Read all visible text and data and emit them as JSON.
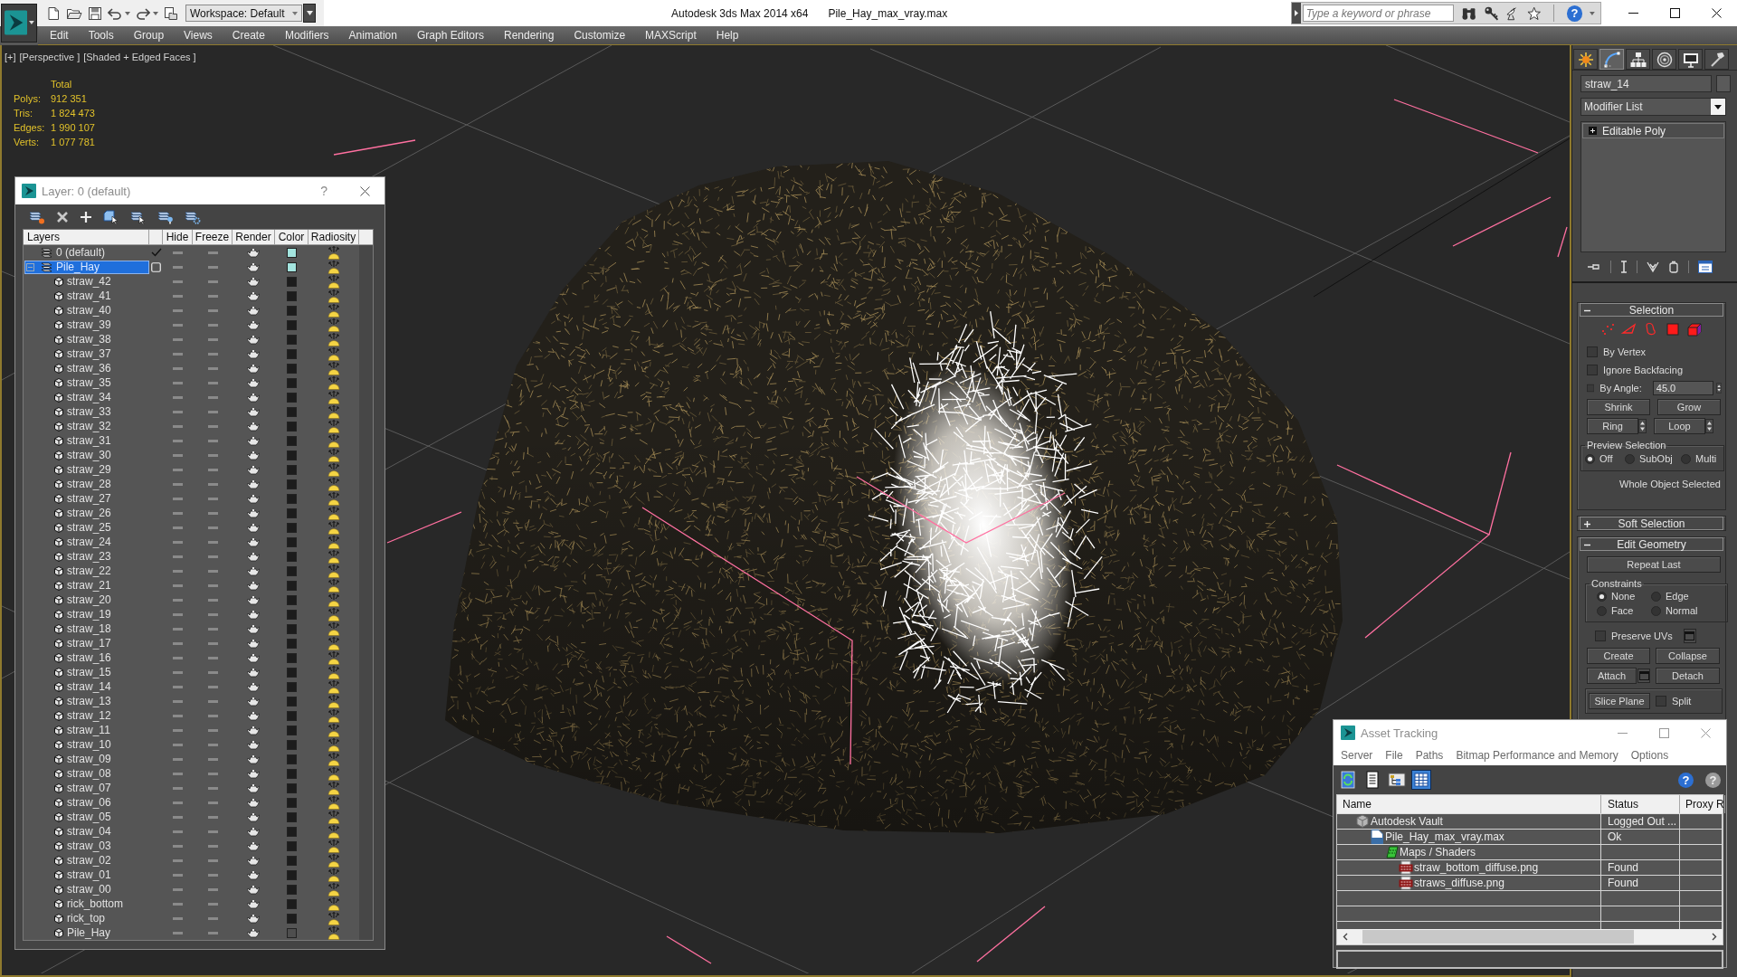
{
  "title_bar": {
    "workspace": "Workspace: Default",
    "app_title": "Autodesk 3ds Max 2014 x64",
    "file_name": "Pile_Hay_max_vray.max",
    "search": {
      "placeholder": "Type a keyword or phrase"
    },
    "help": "?"
  },
  "menu": [
    "Edit",
    "Tools",
    "Group",
    "Views",
    "Create",
    "Modifiers",
    "Animation",
    "Graph Editors",
    "Rendering",
    "Customize",
    "MAXScript",
    "Help"
  ],
  "viewport": {
    "labels": [
      "[+]",
      "[Perspective ]",
      "[Shaded + Edged Faces ]"
    ],
    "stats": {
      "header": "Total",
      "rows": [
        {
          "label": "Polys:",
          "value": "912 351"
        },
        {
          "label": "Tris:",
          "value": "1 824 473"
        },
        {
          "label": "Edges:",
          "value": "1 990 107"
        },
        {
          "label": "Verts:",
          "value": "1 077 781"
        }
      ]
    }
  },
  "layer_window": {
    "title": "Layer: 0 (default)",
    "help": "?",
    "columns": [
      "Layers",
      "Hide",
      "Freeze",
      "Render",
      "Color",
      "Radiosity"
    ],
    "layers": [
      {
        "name": "0 (default)",
        "current": true,
        "selected": false,
        "hidden": false,
        "frozen": false,
        "renderable": true,
        "radiosity": true,
        "color": "#a3e4de"
      },
      {
        "name": "Pile_Hay",
        "current": false,
        "selected": true,
        "expanded": true,
        "hidden": false,
        "frozen": false,
        "renderable": true,
        "radiosity": true,
        "color": "#a3e4de",
        "children": [
          {
            "name": "straw_42",
            "selected": false,
            "hidden": false,
            "frozen": false,
            "renderable": true,
            "radiosity": true,
            "color": "#1c1c1c"
          },
          {
            "name": "straw_41",
            "selected": false,
            "hidden": false,
            "frozen": false,
            "renderable": true,
            "radiosity": true,
            "color": "#1c1c1c"
          },
          {
            "name": "straw_40",
            "selected": false,
            "hidden": false,
            "frozen": false,
            "renderable": true,
            "radiosity": true,
            "color": "#1c1c1c"
          },
          {
            "name": "straw_39",
            "selected": false,
            "hidden": false,
            "frozen": false,
            "renderable": true,
            "radiosity": true,
            "color": "#1c1c1c"
          },
          {
            "name": "straw_38",
            "selected": false,
            "hidden": false,
            "frozen": false,
            "renderable": true,
            "radiosity": true,
            "color": "#1c1c1c"
          },
          {
            "name": "straw_37",
            "selected": false,
            "hidden": false,
            "frozen": false,
            "renderable": true,
            "radiosity": true,
            "color": "#1c1c1c"
          },
          {
            "name": "straw_36",
            "selected": false,
            "hidden": false,
            "frozen": false,
            "renderable": true,
            "radiosity": true,
            "color": "#1c1c1c"
          },
          {
            "name": "straw_35",
            "selected": false,
            "hidden": false,
            "frozen": false,
            "renderable": true,
            "radiosity": true,
            "color": "#1c1c1c"
          },
          {
            "name": "straw_34",
            "selected": false,
            "hidden": false,
            "frozen": false,
            "renderable": true,
            "radiosity": true,
            "color": "#1c1c1c"
          },
          {
            "name": "straw_33",
            "selected": false,
            "hidden": false,
            "frozen": false,
            "renderable": true,
            "radiosity": true,
            "color": "#1c1c1c"
          },
          {
            "name": "straw_32",
            "selected": false,
            "hidden": false,
            "frozen": false,
            "renderable": true,
            "radiosity": true,
            "color": "#1c1c1c"
          },
          {
            "name": "straw_31",
            "selected": false,
            "hidden": false,
            "frozen": false,
            "renderable": true,
            "radiosity": true,
            "color": "#1c1c1c"
          },
          {
            "name": "straw_30",
            "selected": false,
            "hidden": false,
            "frozen": false,
            "renderable": true,
            "radiosity": true,
            "color": "#1c1c1c"
          },
          {
            "name": "straw_29",
            "selected": false,
            "hidden": false,
            "frozen": false,
            "renderable": true,
            "radiosity": true,
            "color": "#1c1c1c"
          },
          {
            "name": "straw_28",
            "selected": false,
            "hidden": false,
            "frozen": false,
            "renderable": true,
            "radiosity": true,
            "color": "#1c1c1c"
          },
          {
            "name": "straw_27",
            "selected": false,
            "hidden": false,
            "frozen": false,
            "renderable": true,
            "radiosity": true,
            "color": "#1c1c1c"
          },
          {
            "name": "straw_26",
            "selected": false,
            "hidden": false,
            "frozen": false,
            "renderable": true,
            "radiosity": true,
            "color": "#1c1c1c"
          },
          {
            "name": "straw_25",
            "selected": false,
            "hidden": false,
            "frozen": false,
            "renderable": true,
            "radiosity": true,
            "color": "#1c1c1c"
          },
          {
            "name": "straw_24",
            "selected": false,
            "hidden": false,
            "frozen": false,
            "renderable": true,
            "radiosity": true,
            "color": "#1c1c1c"
          },
          {
            "name": "straw_23",
            "selected": false,
            "hidden": false,
            "frozen": false,
            "renderable": true,
            "radiosity": true,
            "color": "#1c1c1c"
          },
          {
            "name": "straw_22",
            "selected": false,
            "hidden": false,
            "frozen": false,
            "renderable": true,
            "radiosity": true,
            "color": "#1c1c1c"
          },
          {
            "name": "straw_21",
            "selected": false,
            "hidden": false,
            "frozen": false,
            "renderable": true,
            "radiosity": true,
            "color": "#1c1c1c"
          },
          {
            "name": "straw_20",
            "selected": false,
            "hidden": false,
            "frozen": false,
            "renderable": true,
            "radiosity": true,
            "color": "#1c1c1c"
          },
          {
            "name": "straw_19",
            "selected": false,
            "hidden": false,
            "frozen": false,
            "renderable": true,
            "radiosity": true,
            "color": "#1c1c1c"
          },
          {
            "name": "straw_18",
            "selected": false,
            "hidden": false,
            "frozen": false,
            "renderable": true,
            "radiosity": true,
            "color": "#1c1c1c"
          },
          {
            "name": "straw_17",
            "selected": false,
            "hidden": false,
            "frozen": false,
            "renderable": true,
            "radiosity": true,
            "color": "#1c1c1c"
          },
          {
            "name": "straw_16",
            "selected": false,
            "hidden": false,
            "frozen": false,
            "renderable": true,
            "radiosity": true,
            "color": "#1c1c1c"
          },
          {
            "name": "straw_15",
            "selected": false,
            "hidden": false,
            "frozen": false,
            "renderable": true,
            "radiosity": true,
            "color": "#1c1c1c"
          },
          {
            "name": "straw_14",
            "selected": false,
            "hidden": false,
            "frozen": false,
            "renderable": true,
            "radiosity": true,
            "color": "#1c1c1c"
          },
          {
            "name": "straw_13",
            "selected": false,
            "hidden": false,
            "frozen": false,
            "renderable": true,
            "radiosity": true,
            "color": "#1c1c1c"
          },
          {
            "name": "straw_12",
            "selected": false,
            "hidden": false,
            "frozen": false,
            "renderable": true,
            "radiosity": true,
            "color": "#1c1c1c"
          },
          {
            "name": "straw_11",
            "selected": false,
            "hidden": false,
            "frozen": false,
            "renderable": true,
            "radiosity": true,
            "color": "#1c1c1c"
          },
          {
            "name": "straw_10",
            "selected": false,
            "hidden": false,
            "frozen": false,
            "renderable": true,
            "radiosity": true,
            "color": "#1c1c1c"
          },
          {
            "name": "straw_09",
            "selected": false,
            "hidden": false,
            "frozen": false,
            "renderable": true,
            "radiosity": true,
            "color": "#1c1c1c"
          },
          {
            "name": "straw_08",
            "selected": false,
            "hidden": false,
            "frozen": false,
            "renderable": true,
            "radiosity": true,
            "color": "#1c1c1c"
          },
          {
            "name": "straw_07",
            "selected": false,
            "hidden": false,
            "frozen": false,
            "renderable": true,
            "radiosity": true,
            "color": "#1c1c1c"
          },
          {
            "name": "straw_06",
            "selected": false,
            "hidden": false,
            "frozen": false,
            "renderable": true,
            "radiosity": true,
            "color": "#1c1c1c"
          },
          {
            "name": "straw_05",
            "selected": false,
            "hidden": false,
            "frozen": false,
            "renderable": true,
            "radiosity": true,
            "color": "#1c1c1c"
          },
          {
            "name": "straw_04",
            "selected": false,
            "hidden": false,
            "frozen": false,
            "renderable": true,
            "radiosity": true,
            "color": "#1c1c1c"
          },
          {
            "name": "straw_03",
            "selected": false,
            "hidden": false,
            "frozen": false,
            "renderable": true,
            "radiosity": true,
            "color": "#1c1c1c"
          },
          {
            "name": "straw_02",
            "selected": false,
            "hidden": false,
            "frozen": false,
            "renderable": true,
            "radiosity": true,
            "color": "#1c1c1c"
          },
          {
            "name": "straw_01",
            "selected": false,
            "hidden": false,
            "frozen": false,
            "renderable": true,
            "radiosity": true,
            "color": "#1c1c1c"
          },
          {
            "name": "straw_00",
            "selected": false,
            "hidden": false,
            "frozen": false,
            "renderable": true,
            "radiosity": true,
            "color": "#1c1c1c"
          },
          {
            "name": "rick_bottom",
            "selected": false,
            "hidden": false,
            "frozen": false,
            "renderable": true,
            "radiosity": true,
            "color": "#1c1c1c"
          },
          {
            "name": "rick_top",
            "selected": false,
            "hidden": false,
            "frozen": false,
            "renderable": true,
            "radiosity": true,
            "color": "#1c1c1c"
          },
          {
            "name": "Pile_Hay",
            "selected": false,
            "hidden": false,
            "frozen": false,
            "renderable": true,
            "radiosity": true,
            "color": "#4e4e4e"
          }
        ]
      }
    ]
  },
  "command_panel": {
    "tabs": [
      {
        "kind": "create",
        "selected": false
      },
      {
        "kind": "modify",
        "selected": true
      },
      {
        "kind": "hierarchy",
        "selected": false
      },
      {
        "kind": "motion",
        "selected": false
      },
      {
        "kind": "display",
        "selected": false
      },
      {
        "kind": "utilities",
        "selected": false
      }
    ],
    "object_name": "straw_14",
    "modifier_list": "Modifier List",
    "stack": [
      {
        "name": "Editable Poly",
        "expanded": false
      }
    ],
    "rollouts": [
      {
        "kind": "selection",
        "title": "Selection",
        "expanded": true,
        "levels": [
          {
            "kind": "vertex",
            "selected": false
          },
          {
            "kind": "edge",
            "selected": false
          },
          {
            "kind": "border",
            "selected": false
          },
          {
            "kind": "polygon",
            "selected": false
          },
          {
            "kind": "element",
            "selected": false
          }
        ],
        "options": [
          {
            "label": "By Vertex",
            "checked": false
          },
          {
            "label": "Ignore Backfacing",
            "checked": false
          },
          {
            "label": "By Angle:",
            "checked": false,
            "value": "45.0"
          }
        ],
        "buttons": [
          "Shrink",
          "Grow"
        ],
        "spin_buttons": [
          "Ring",
          "Loop"
        ],
        "preview": {
          "title": "Preview Selection",
          "options": [
            {
              "label": "Off",
              "selected": true
            },
            {
              "label": "SubObj",
              "selected": false
            },
            {
              "label": "Multi",
              "selected": false
            }
          ]
        },
        "status": "Whole Object Selected"
      },
      {
        "title": "Soft Selection",
        "expanded": false
      },
      {
        "kind": "geometry",
        "title": "Edit Geometry",
        "expanded": true,
        "repeat": "Repeat Last",
        "constraints": {
          "title": "Constraints",
          "options": [
            {
              "label": "None",
              "selected": true
            },
            {
              "label": "Edge",
              "selected": false
            },
            {
              "label": "Face",
              "selected": false
            },
            {
              "label": "Normal",
              "selected": false
            }
          ]
        },
        "preserve_uvs": {
          "label": "Preserve UVs",
          "checked": false,
          "settings": true
        },
        "buttons": [
          {
            "label": "Create",
            "settings": false
          },
          {
            "label": "Collapse",
            "settings": false
          },
          {
            "label": "Attach",
            "settings": true
          },
          {
            "label": "Detach",
            "settings": false
          }
        ],
        "slice": {
          "label": "Slice Plane"
        },
        "split": {
          "label": "Split",
          "checked": false
        }
      }
    ]
  },
  "asset_tracking": {
    "title": "Asset Tracking",
    "menu": [
      "Server",
      "File",
      "Paths",
      "Bitmap Performance and Memory",
      "Options"
    ],
    "toolbar": [
      {
        "kind": "refresh",
        "selected": false
      },
      {
        "kind": "list",
        "selected": false
      },
      {
        "kind": "tree",
        "selected": false
      },
      {
        "kind": "table",
        "selected": true
      }
    ],
    "help": [
      "?",
      "?"
    ],
    "columns": [
      "Name",
      "Status",
      "Proxy R"
    ],
    "rows": [
      {
        "name": "Autodesk Vault",
        "kind": "vault",
        "status": "Logged Out ...",
        "selected": false,
        "children": [
          {
            "name": "Pile_Hay_max_vray.max",
            "kind": "max",
            "status": "Ok",
            "selected": false,
            "children": [
              {
                "name": "Maps / Shaders",
                "kind": "maps",
                "selected": false,
                "children": [
                  {
                    "name": "straw_bottom_diffuse.png",
                    "kind": "png",
                    "status": "Found",
                    "selected": false
                  },
                  {
                    "name": "straws_diffuse.png",
                    "kind": "png",
                    "status": "Found",
                    "selected": false
                  }
                ]
              }
            ]
          }
        ]
      }
    ]
  }
}
